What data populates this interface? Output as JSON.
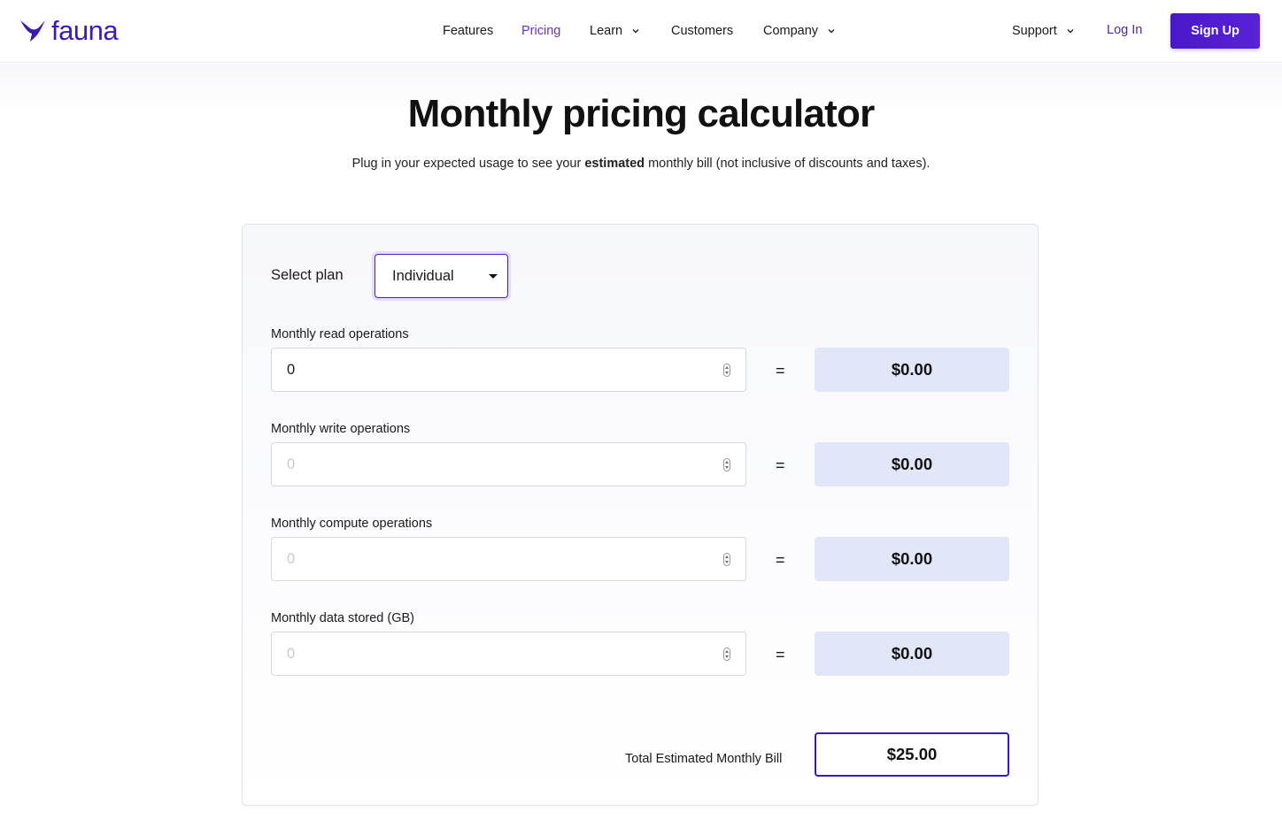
{
  "brand": {
    "name": "fauna",
    "color": "#3a1ab6",
    "logo_icon": "bird-logo-icon"
  },
  "nav": {
    "items": [
      {
        "label": "Features",
        "dropdown": false,
        "active": false
      },
      {
        "label": "Pricing",
        "dropdown": false,
        "active": true
      },
      {
        "label": "Learn",
        "dropdown": true,
        "active": false
      },
      {
        "label": "Customers",
        "dropdown": false,
        "active": false
      },
      {
        "label": "Company",
        "dropdown": true,
        "active": false
      }
    ],
    "support": "Support",
    "login": "Log In",
    "signup": "Sign Up"
  },
  "page": {
    "title": "Monthly pricing calculator",
    "subtitle_pre": "Plug in your expected usage to see your ",
    "subtitle_bold": "estimated",
    "subtitle_post": " monthly bill (not inclusive of discounts and taxes)."
  },
  "calculator": {
    "plan_label": "Select plan",
    "plan_value": "Individual",
    "rows": [
      {
        "label": "Monthly read operations",
        "value": "0",
        "placeholder": "",
        "equals": "=",
        "cost": "$0.00"
      },
      {
        "label": "Monthly write operations",
        "value": "",
        "placeholder": "0",
        "equals": "=",
        "cost": "$0.00"
      },
      {
        "label": "Monthly compute operations",
        "value": "",
        "placeholder": "0",
        "equals": "=",
        "cost": "$0.00"
      },
      {
        "label": "Monthly data stored (GB)",
        "value": "",
        "placeholder": "0",
        "equals": "=",
        "cost": "$0.00"
      }
    ],
    "total_label": "Total Estimated Monthly Bill",
    "total_value": "$25.00"
  },
  "colors": {
    "accent": "#4a18c8",
    "cost_bg": "#e1e6f8",
    "active_nav": "#6a2fc0"
  }
}
